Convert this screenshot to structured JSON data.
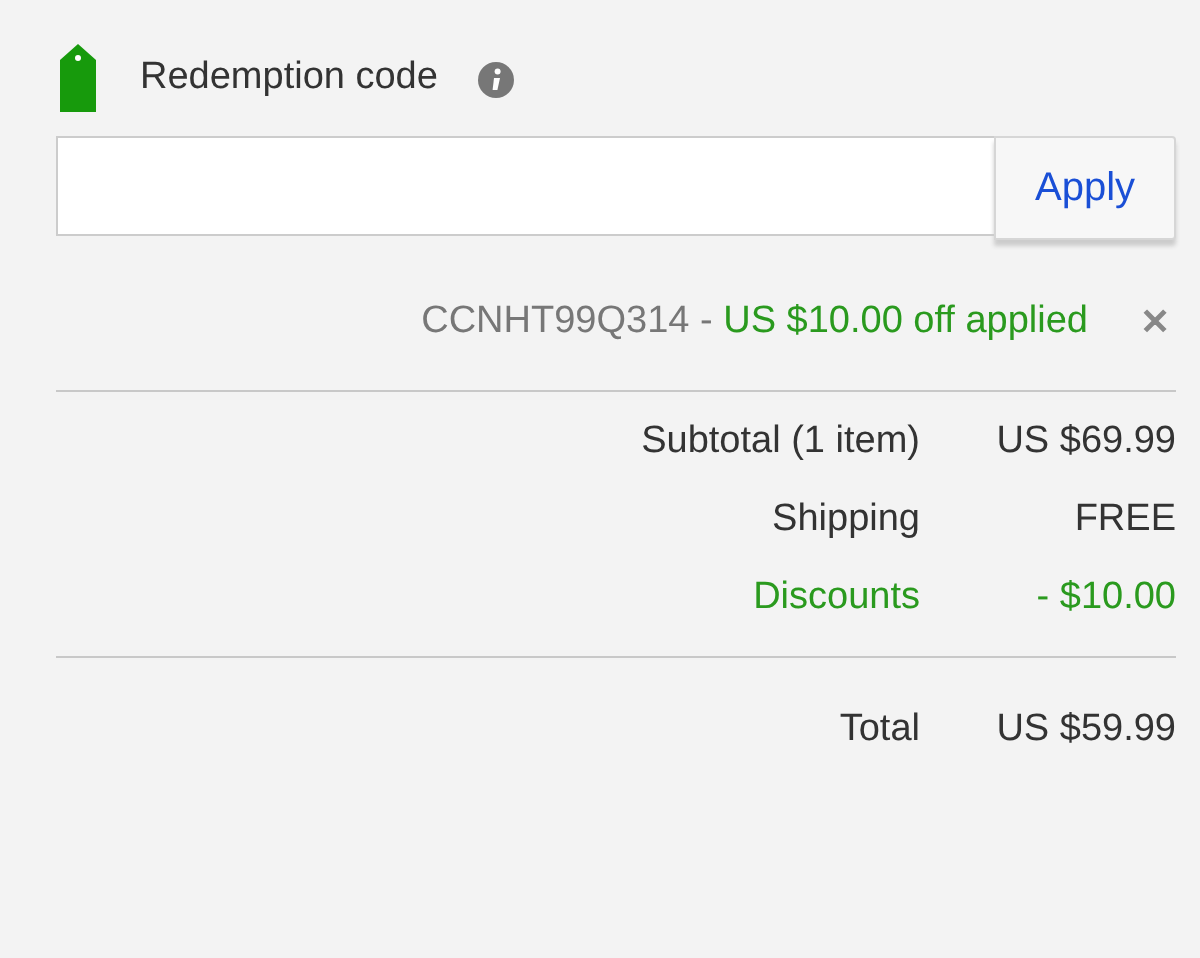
{
  "redemption": {
    "label": "Redemption code",
    "button": "Apply"
  },
  "applied": {
    "code": "CCNHT99Q314",
    "separator": "-",
    "message": "US $10.00 off applied",
    "remove": "✕"
  },
  "summary": [
    {
      "kind": "normal",
      "label": "Subtotal (1 item)",
      "value": "US $69.99"
    },
    {
      "kind": "normal",
      "label": "Shipping",
      "value": "FREE"
    },
    {
      "kind": "discount",
      "label": "Discounts",
      "value": "- $10.00"
    }
  ],
  "total": {
    "label": "Total",
    "value": "US $59.99"
  }
}
